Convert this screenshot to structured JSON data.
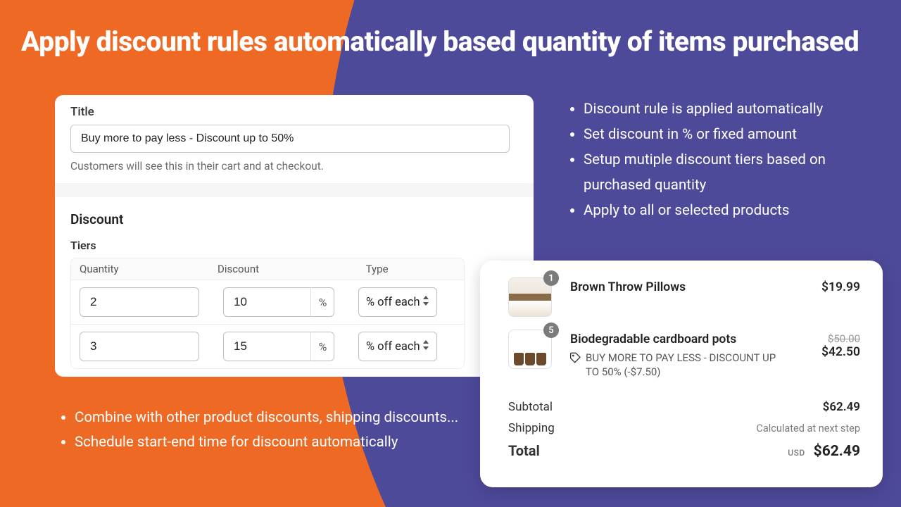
{
  "headline": "Apply discount rules automatically based quantity of items purchased",
  "settings": {
    "title_label": "Title",
    "title_value": "Buy more to pay less - Discount up to 50%",
    "helper": "Customers will see this in their cart and at checkout.",
    "discount_heading": "Discount",
    "tiers_label": "Tiers",
    "col_qty": "Quantity",
    "col_disc": "Discount",
    "col_type": "Type",
    "percent": "%",
    "tiers": [
      {
        "qty": "2",
        "disc": "10",
        "type": "% off each"
      },
      {
        "qty": "3",
        "disc": "15",
        "type": "% off each"
      }
    ]
  },
  "right_bullets": [
    "Discount rule is applied automatically",
    "Set discount in % or fixed amount",
    "Setup mutiple discount tiers based on purchased quantity",
    "Apply to all or selected products"
  ],
  "bottom_bullets": [
    "Combine with other product discounts, shipping discounts...",
    "Schedule start-end time for discount automatically"
  ],
  "cart": {
    "items": [
      {
        "qty_badge": "1",
        "name": "Brown Throw Pillows",
        "promo": "",
        "old_price": "",
        "price": "$19.99"
      },
      {
        "qty_badge": "5",
        "name": "Biodegradable cardboard pots",
        "promo": "BUY MORE TO PAY LESS - DISCOUNT UP TO 50% (-$7.50)",
        "old_price": "$50.00",
        "price": "$42.50"
      }
    ],
    "subtotal_label": "Subtotal",
    "subtotal": "$62.49",
    "shipping_label": "Shipping",
    "shipping_note": "Calculated at next step",
    "total_label": "Total",
    "currency": "USD",
    "total": "$62.49"
  }
}
